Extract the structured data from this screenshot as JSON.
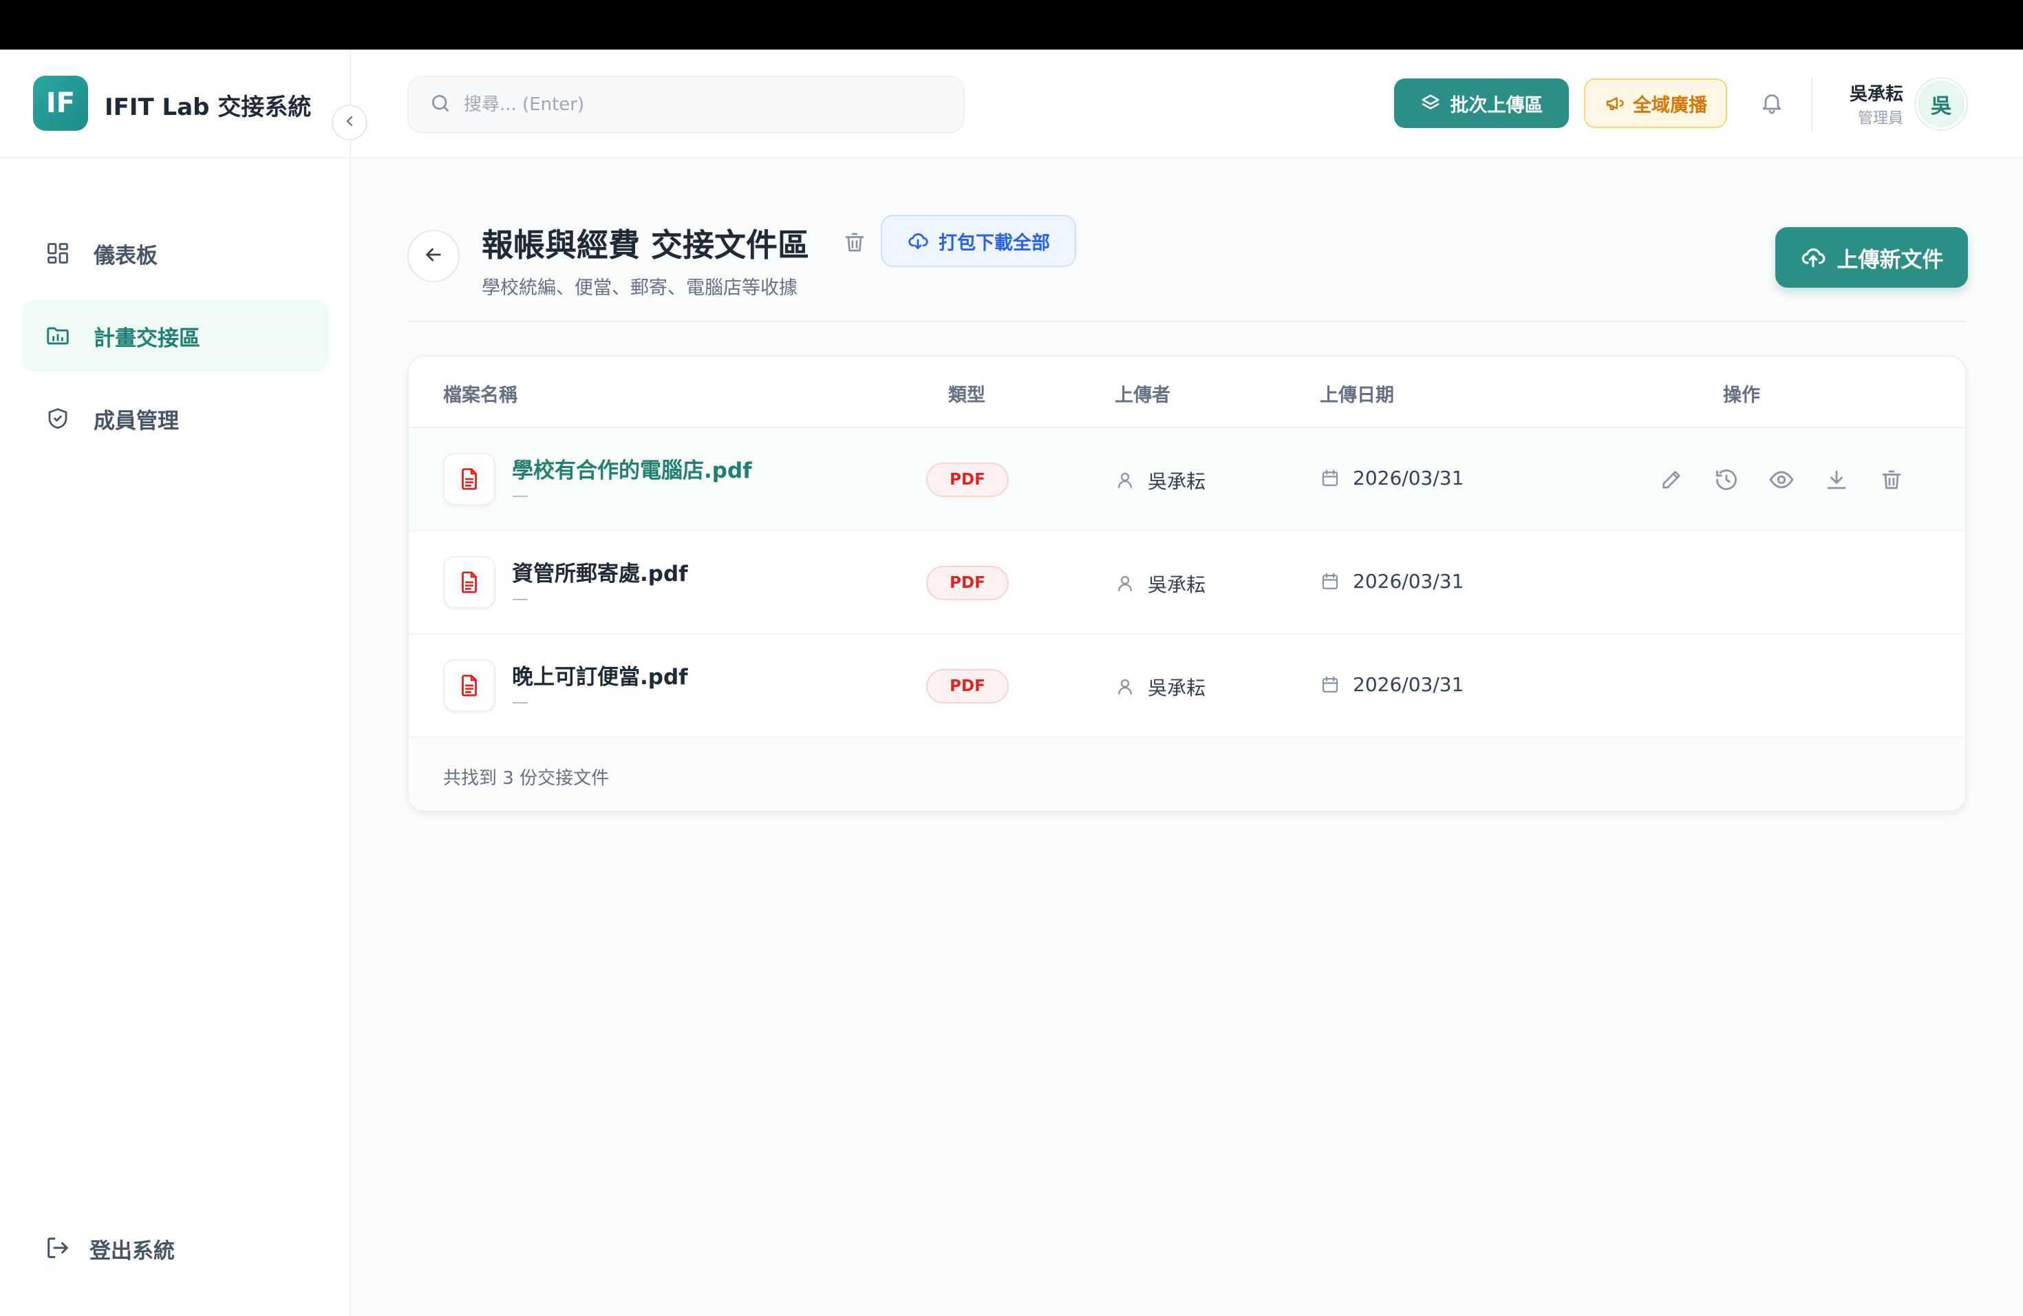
{
  "brand": {
    "logo_text": "IF",
    "title": "IFIT Lab 交接系統"
  },
  "sidebar": {
    "items": [
      {
        "label": "儀表板",
        "icon": "dashboard-icon",
        "active": false
      },
      {
        "label": "計畫交接區",
        "icon": "folder-chart-icon",
        "active": true
      },
      {
        "label": "成員管理",
        "icon": "shield-check-icon",
        "active": false
      }
    ],
    "logout_label": "登出系統"
  },
  "header": {
    "search_placeholder": "搜尋... (Enter)",
    "batch_upload_label": "批次上傳區",
    "broadcast_label": "全域廣播",
    "user": {
      "name": "吳承耘",
      "role": "管理員",
      "avatar_text": "吳"
    }
  },
  "page": {
    "title": "報帳與經費 交接文件區",
    "subtitle": "學校統編、便當、郵寄、電腦店等收據",
    "zip_download_label": "打包下載全部",
    "upload_label": "上傳新文件"
  },
  "table": {
    "columns": [
      "檔案名稱",
      "類型",
      "上傳者",
      "上傳日期",
      "操作"
    ],
    "rows": [
      {
        "name": "學校有合作的電腦店.pdf",
        "desc": "—",
        "type": "PDF",
        "uploader": "吳承耘",
        "date": "2026/03/31"
      },
      {
        "name": "資管所郵寄處.pdf",
        "desc": "—",
        "type": "PDF",
        "uploader": "吳承耘",
        "date": "2026/03/31"
      },
      {
        "name": "晚上可訂便當.pdf",
        "desc": "—",
        "type": "PDF",
        "uploader": "吳承耘",
        "date": "2026/03/31"
      }
    ],
    "footer": "共找到 3 份交接文件"
  },
  "colors": {
    "primary": "#2b8f86",
    "accent_text": "#1f7f73",
    "warning": "#d97706",
    "danger": "#dc2626",
    "info": "#2563eb"
  }
}
